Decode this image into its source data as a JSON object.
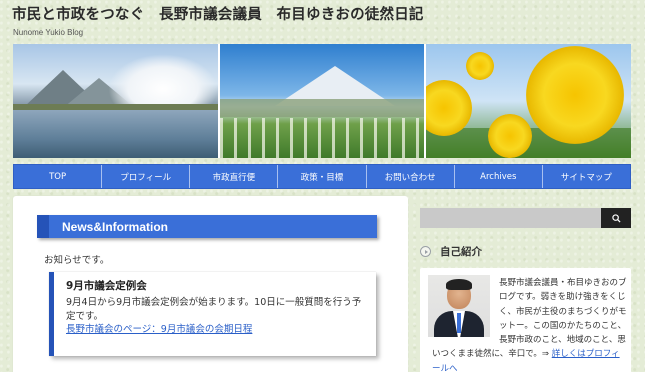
{
  "site": {
    "title": "市民と市政をつなぐ　長野市議会議員　布目ゆきおの徒然日記",
    "subtitle": "Nunome Yukio Blog"
  },
  "nav": {
    "items": [
      {
        "label": "TOP"
      },
      {
        "label": "プロフィール"
      },
      {
        "label": "市政直行便"
      },
      {
        "label": "政策・目標"
      },
      {
        "label": "お問い合わせ"
      },
      {
        "label": "Archives"
      },
      {
        "label": "サイトマップ"
      }
    ]
  },
  "news": {
    "header": "News&Information",
    "notice": "お知らせです。",
    "item": {
      "title": "9月市議会定例会",
      "body": "9月4日から9月市議会定例会が始まります。10日に一般質問を行う予定です。",
      "link": "長野市議会のページ：9月市議会の会期日程"
    }
  },
  "search": {
    "placeholder": "",
    "icon": "search-icon"
  },
  "profile": {
    "widget_title": "自己紹介",
    "text": "長野市議会議員・布目ゆきおのブログです。弱きを助け強きをくじく、市民が主役のまちづくりがモットー。この国のかたちのこと、長野市政のこと、地域のこと、思いつくまま徒然に、辛口で。⇒ ",
    "link": "詳しくはプロフィールへ"
  },
  "colors": {
    "accent": "#3a6fd8",
    "accent_dark": "#2553b8",
    "link": "#2a5fc8"
  }
}
